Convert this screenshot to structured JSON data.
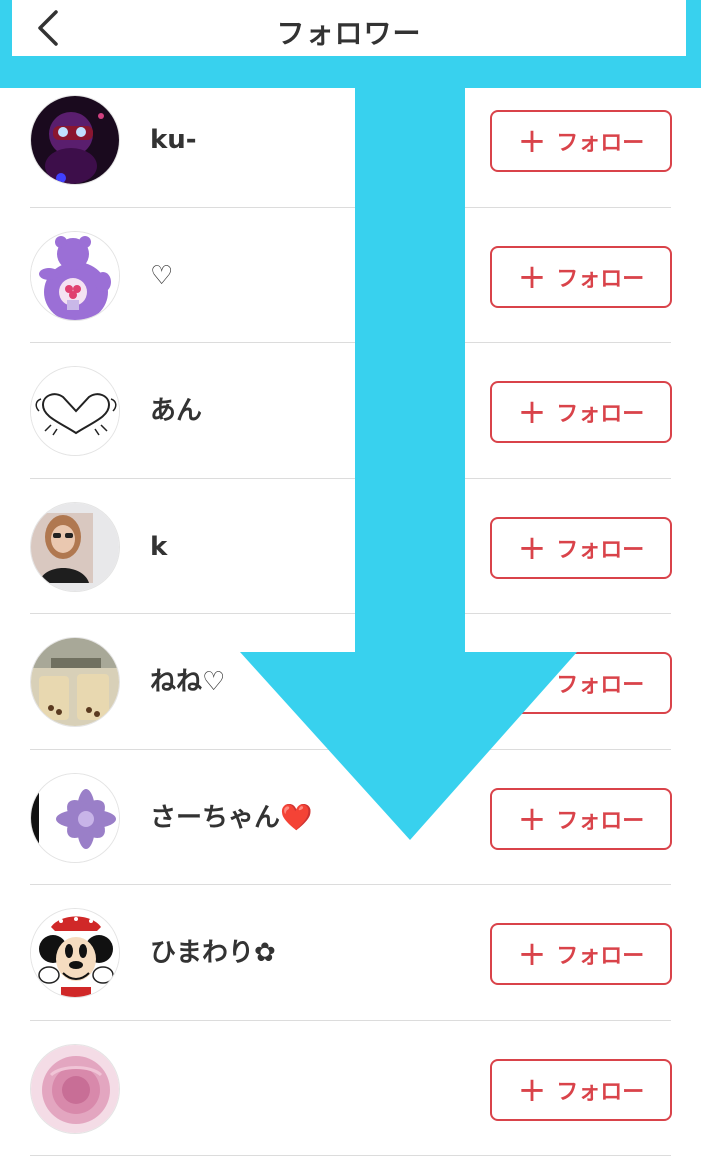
{
  "header": {
    "title": "フォロワー",
    "back_icon": "chevron-left-icon"
  },
  "follow_label": "フォロー",
  "plus_symbol": "+",
  "colors": {
    "accent_red": "#d9434a",
    "overlay_cyan": "#38d1ee",
    "text": "#333333",
    "divider": "#dcdcdc"
  },
  "followers": [
    {
      "name": "ku-",
      "avatar": "dark-purple-portrait"
    },
    {
      "name": "♡",
      "avatar": "purple-care-bear"
    },
    {
      "name": "あん",
      "avatar": "heart-hands-drawing"
    },
    {
      "name": "k",
      "avatar": "woman-sunglasses-photo"
    },
    {
      "name": "ねね♡",
      "avatar": "bubble-tea-cups"
    },
    {
      "name": "さーちゃん❤️",
      "avatar": "purple-flower-rady"
    },
    {
      "name": "ひまわり✿",
      "avatar": "minnie-mouse"
    },
    {
      "name": "",
      "avatar": "pink-rose"
    }
  ]
}
